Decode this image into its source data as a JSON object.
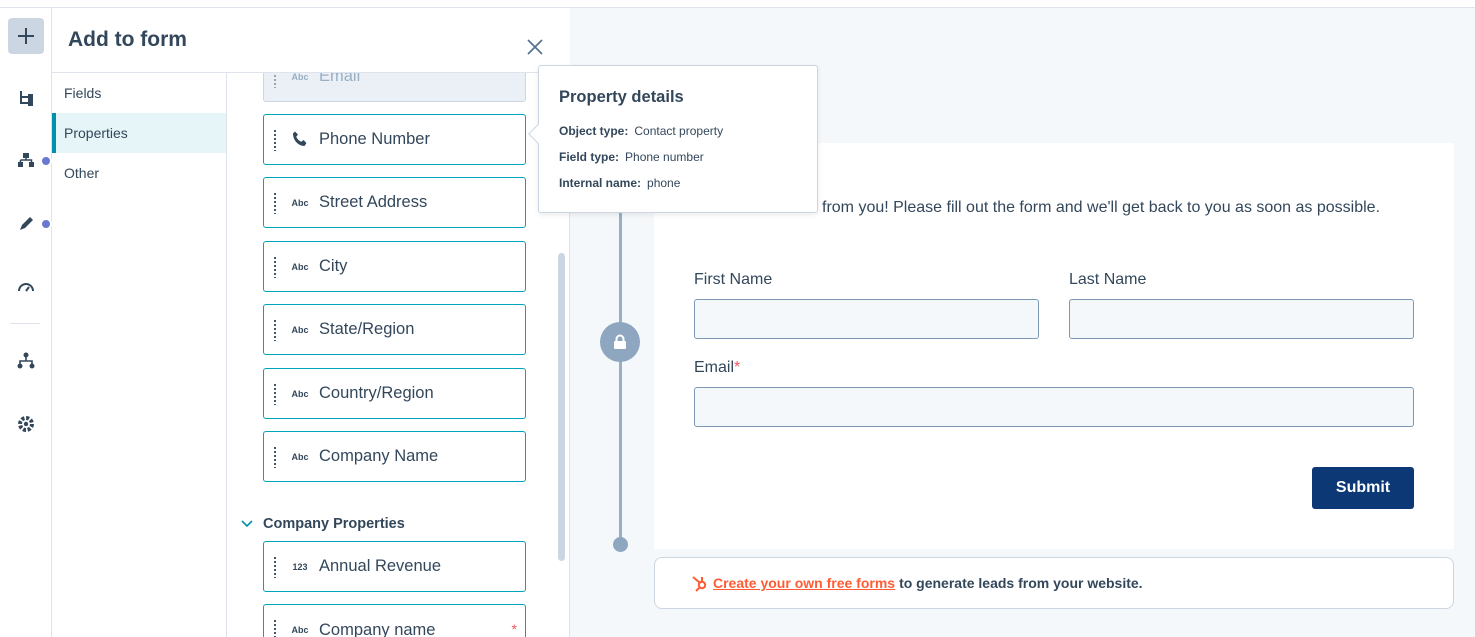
{
  "panel": {
    "title": "Add to form",
    "tabs": [
      {
        "label": "Fields"
      },
      {
        "label": "Properties"
      },
      {
        "label": "Other"
      }
    ],
    "fields": [
      {
        "icon": "Abc",
        "label": "Email",
        "disabled": true
      },
      {
        "icon": "phone-icon",
        "label": "Phone Number"
      },
      {
        "icon": "Abc",
        "label": "Street Address"
      },
      {
        "icon": "Abc",
        "label": "City"
      },
      {
        "icon": "Abc",
        "label": "State/Region"
      },
      {
        "icon": "Abc",
        "label": "Country/Region"
      },
      {
        "icon": "Abc",
        "label": "Company Name"
      }
    ],
    "section_title": "Company Properties",
    "company_fields": [
      {
        "icon": "123",
        "label": "Annual Revenue"
      },
      {
        "icon": "Abc",
        "label": "Company name",
        "required_mark": "*"
      }
    ]
  },
  "tooltip": {
    "title": "Property details",
    "rows": [
      {
        "key": "Object type:",
        "value": "Contact property"
      },
      {
        "key": "Field type:",
        "value": "Phone number"
      },
      {
        "key": "Internal name:",
        "value": "phone"
      }
    ]
  },
  "form": {
    "intro": "from you! Please fill out the form and we'll get back to you as soon as possible.",
    "first_name_label": "First Name",
    "last_name_label": "Last Name",
    "email_label": "Email",
    "email_required": "*",
    "submit_label": "Submit"
  },
  "promo": {
    "link_text": "Create your own free forms",
    "suffix": "to generate leads from your website."
  },
  "colors": {
    "accent": "#00a4bd",
    "submit": "#0c3875",
    "brand_orange": "#ff5c35",
    "nav_dot": "#6a78d1"
  }
}
